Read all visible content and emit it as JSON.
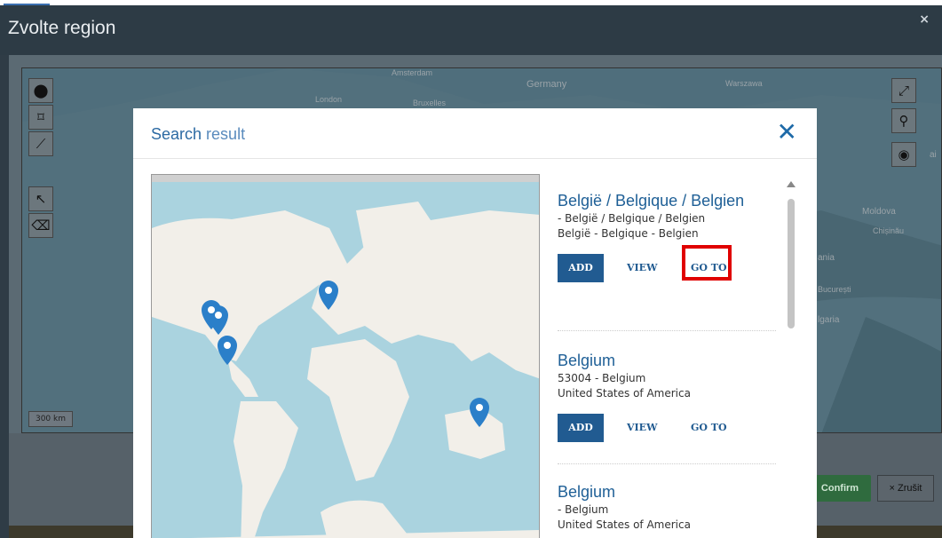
{
  "outer": {
    "title": "Zvolte region",
    "close": "×",
    "confirm_label": "Confirm",
    "cancel_label": "× Zrušit",
    "scale_label": "300 km",
    "map_labels": [
      "Amsterdam",
      "Germany",
      "Warszawa",
      "London",
      "Bruxelles",
      "Moldova",
      "Chișinău",
      "ania",
      "București",
      "lgaria",
      "ai"
    ]
  },
  "modal": {
    "title_main": "Search",
    "title_light": " result",
    "close": "✕"
  },
  "results": [
    {
      "title": "België / Belgique / Belgien",
      "line1": "- België / Belgique / Belgien",
      "line2": "België - Belgique - Belgien",
      "add": "ADD",
      "view": "VIEW",
      "goto": "GO TO"
    },
    {
      "title": "Belgium",
      "line1": "53004 - Belgium",
      "line2": "United States of America",
      "add": "ADD",
      "view": "VIEW",
      "goto": "GO TO"
    },
    {
      "title": "Belgium",
      "line1": "- Belgium",
      "line2": "United States of America"
    }
  ],
  "icons": {
    "marker": "map-pin-icon",
    "polygon": "polygon-icon",
    "line": "polyline-icon",
    "select": "cursor-icon",
    "eraser": "eraser-icon",
    "expand": "expand-icon",
    "search": "search-icon",
    "eye": "eye-icon"
  },
  "colors": {
    "accent": "#215b91",
    "highlight": "#e00000",
    "confirm": "#2f6b3e"
  }
}
